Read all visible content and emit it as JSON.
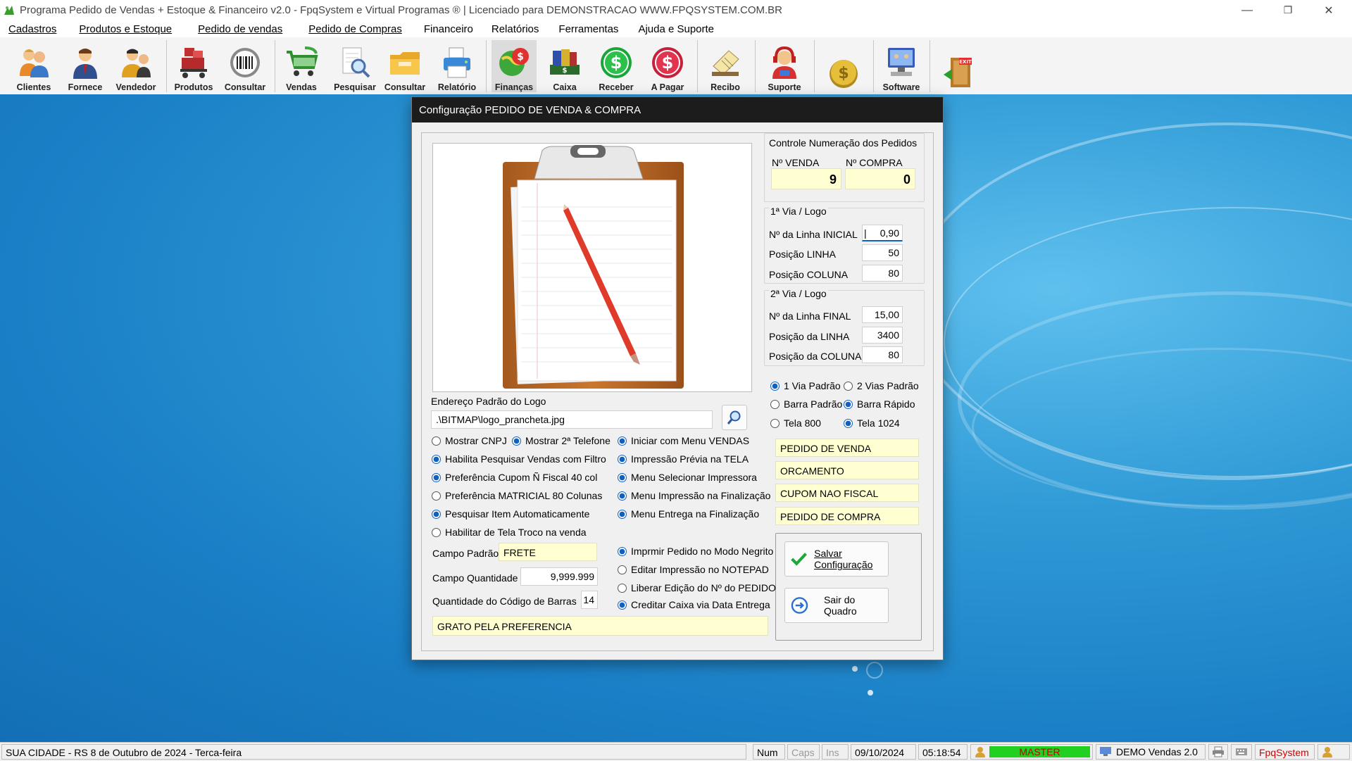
{
  "window": {
    "title": "Programa Pedido de Vendas + Estoque & Financeiro v2.0 - FpqSystem e Virtual Programas ® | Licenciado para  DEMONSTRACAO WWW.FPQSYSTEM.COM.BR",
    "minimize": "—",
    "restore": "❐",
    "close": "✕"
  },
  "menu": [
    {
      "label": "Cadastros"
    },
    {
      "label": "Produtos e Estoque"
    },
    {
      "label": "Pedido de vendas"
    },
    {
      "label": "Pedido de Compras"
    },
    {
      "label": "Financeiro"
    },
    {
      "label": "Relatórios"
    },
    {
      "label": "Ferramentas"
    },
    {
      "label": "Ajuda e Suporte"
    }
  ],
  "toolbar": {
    "clientes": "Clientes",
    "fornece": "Fornece",
    "vendedor": "Vendedor",
    "produtos": "Produtos",
    "consultar1": "Consultar",
    "vendas": "Vendas",
    "pesquisar": "Pesquisar",
    "consultar2": "Consultar",
    "relatorio": "Relatório",
    "financas": "Finanças",
    "caixa": "Caixa",
    "receber": "Receber",
    "apagar": "A Pagar",
    "recibo": "Recibo",
    "suporte": "Suporte",
    "software": "Software",
    "exit_text": "EXIT"
  },
  "dialog": {
    "title": "Configuração PEDIDO DE VENDA & COMPRA",
    "numeracao": {
      "title": "Controle Numeração dos Pedidos",
      "venda_label": "Nº VENDA",
      "compra_label": "Nº COMPRA",
      "venda_value": "9",
      "compra_value": "0"
    },
    "via1": {
      "title": "1ª Via / Logo",
      "linha_inicial_label": "Nº da Linha INICIAL",
      "linha_inicial_value": "0,90",
      "posicao_linha_label": "Posição LINHA",
      "posicao_linha_value": "50",
      "posicao_coluna_label": "Posição COLUNA",
      "posicao_coluna_value": "80"
    },
    "via2": {
      "title": "2ª Via / Logo",
      "linha_final_label": "Nº da Linha FINAL",
      "linha_final_value": "15,00",
      "posicao_linha_label": "Posição da LINHA",
      "posicao_linha_value": "3400",
      "posicao_coluna_label": "Posição da COLUNA",
      "posicao_coluna_value": "80"
    },
    "logo_path_label": "Endereço Padrão do Logo",
    "logo_path_value": ".\\BITMAP\\logo_prancheta.jpg",
    "left_options": {
      "mostrar_cnpj": "Mostrar CNPJ",
      "mostrar_2_telefone": "Mostrar 2ª Telefone",
      "habilita_pesquisar": "Habilita Pesquisar Vendas com Filtro",
      "preferencia_cupom": "Preferência Cupom Ñ Fiscal 40 col",
      "preferencia_matricial": "Preferência MATRICIAL 80 Colunas",
      "pesquisar_item": "Pesquisar Item Automaticamente",
      "habilitar_troco": "Habilitar de Tela Troco na venda"
    },
    "mid_options": {
      "iniciar_menu": "Iniciar com Menu VENDAS",
      "impressao_previa": "Impressão Prévia na TELA",
      "menu_selecionar": "Menu Selecionar Impressora",
      "menu_impressao": "Menu Impressão na Finalização",
      "menu_entrega": "Menu Entrega na Finalização",
      "imprimir_negrito": "Imprmir Pedido no Modo Negrito",
      "editar_notepad": "Editar Impressão no NOTEPAD",
      "liberar_edicao": "Liberar Edição do Nº do PEDIDO",
      "creditar_caixa": "Creditar Caixa via Data Entrega"
    },
    "right_options": {
      "via1_padrao": "1 Via Padrão",
      "vias2_padrao": "2 Vias Padrão",
      "barra_padrao": "Barra Padrão",
      "barra_rapido": "Barra Rápido",
      "tela_800": "Tela 800",
      "tela_1024": "Tela 1024"
    },
    "titles": {
      "pedido_venda": "PEDIDO DE VENDA",
      "orcamento": "ORCAMENTO",
      "cupom": "CUPOM NAO FISCAL",
      "pedido_compra": "PEDIDO DE COMPRA"
    },
    "campo_padrao_label": "Campo Padrão",
    "campo_padrao_value": "FRETE",
    "campo_quantidade_label": "Campo Quantidade",
    "campo_quantidade_value": "9,999.999",
    "qtd_codigo_barras_label": "Quantidade do Código de Barras",
    "qtd_codigo_barras_value": "14",
    "mensagem_value": "GRATO PELA PREFERENCIA",
    "salvar_label": "Salvar Configuração",
    "sair_label": "Sair do Quadro"
  },
  "status": {
    "city_date": "SUA CIDADE - RS  8 de Outubro de 2024 - Terca-feira",
    "num": "Num",
    "caps": "Caps",
    "ins": "Ins",
    "date": "09/10/2024",
    "time": "05:18:54",
    "user": "MASTER",
    "edition": "DEMO Vendas 2.0",
    "brand": "FpqSystem"
  },
  "colors": {
    "accent": "#1060c0",
    "yellow_field": "#ffffd2",
    "status_green": "#22d022",
    "brand_red": "#d00000"
  }
}
